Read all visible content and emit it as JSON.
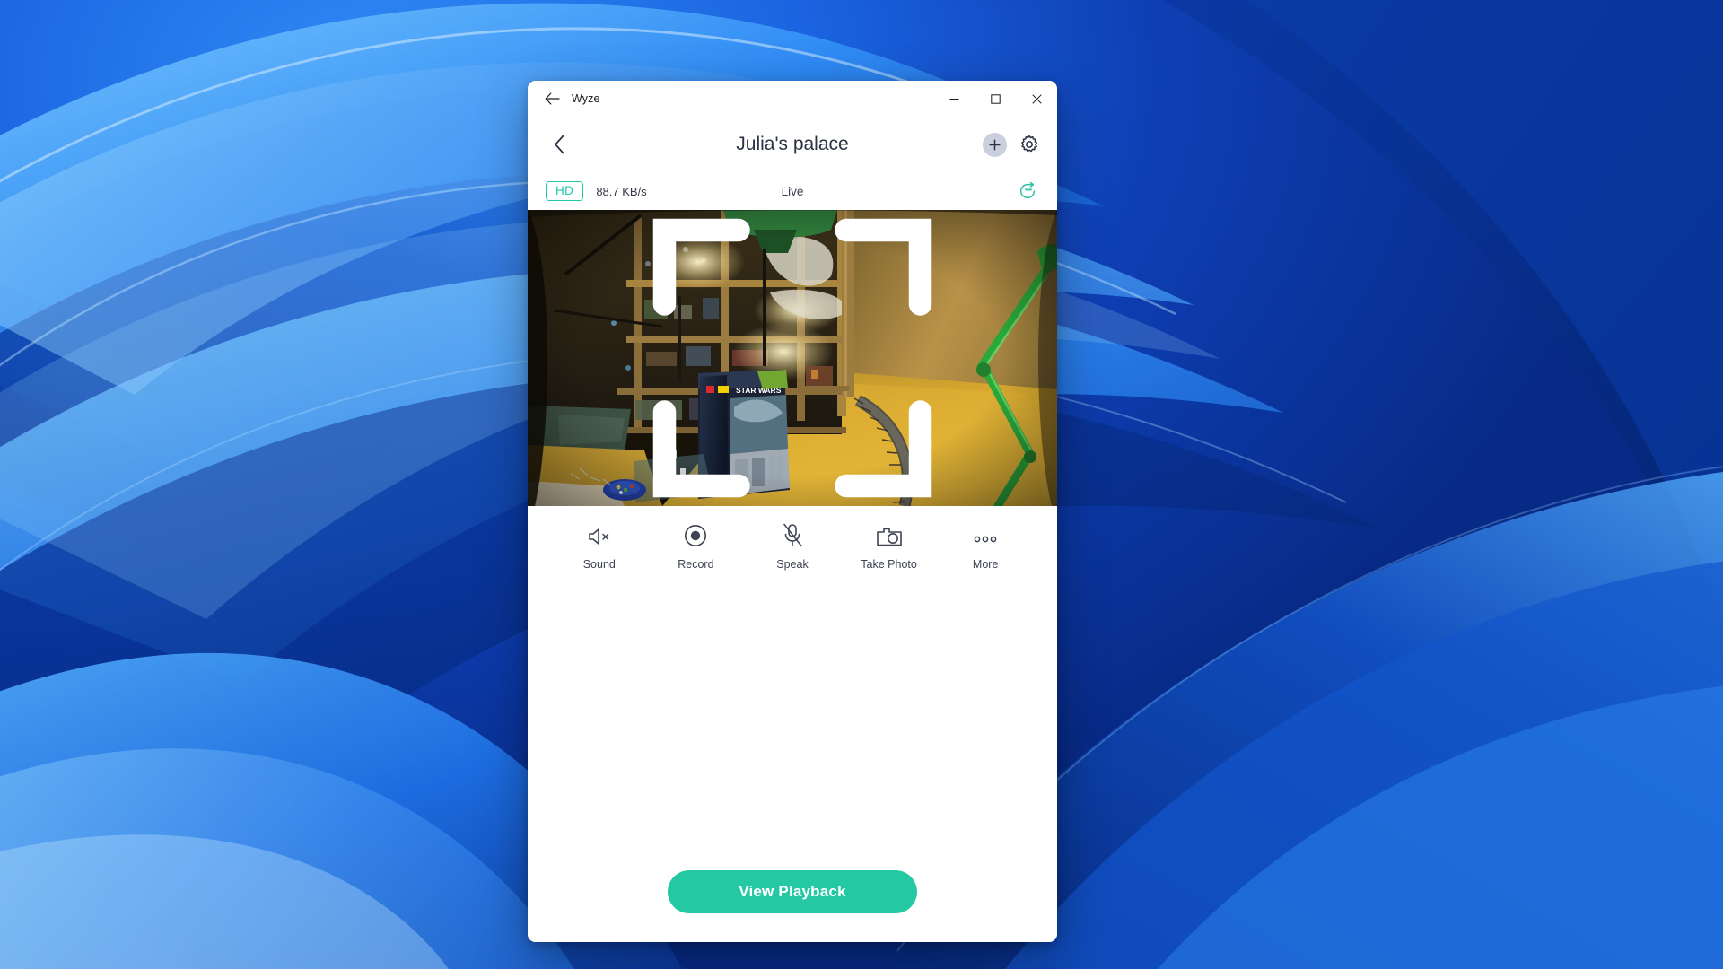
{
  "desktop": {
    "wallpaper_name": "windows-11-bloom-blue"
  },
  "window": {
    "titlebar": {
      "back_icon": "arrow-left-icon",
      "app_title": "Wyze",
      "minimize_label": "–",
      "maximize_label": "□",
      "close_label": "✕"
    },
    "header": {
      "back_icon": "chevron-left-icon",
      "title": "Julia's palace",
      "add_icon": "plus-circle-icon",
      "settings_icon": "gear-icon"
    },
    "status": {
      "quality_badge": "HD",
      "bitrate": "88.7 KB/s",
      "live_label": "Live",
      "flip_icon": "rotate-flip-icon",
      "badge_color": "#1fc9a8"
    },
    "video": {
      "fullscreen_icon": "fullscreen-expand-icon",
      "scene_description": "Indoor LEGO workshop room with wooden shelving, Star Wars LEGO box, train track on wooden floor and a green desk lamp"
    },
    "controls": [
      {
        "label": "Sound",
        "icon": "speaker-muted-icon"
      },
      {
        "label": "Record",
        "icon": "record-circle-icon"
      },
      {
        "label": "Speak",
        "icon": "microphone-muted-icon"
      },
      {
        "label": "Take Photo",
        "icon": "camera-icon"
      },
      {
        "label": "More",
        "icon": "ellipsis-icon"
      }
    ],
    "footer": {
      "playback_label": "View Playback",
      "playback_color": "#24c9a4"
    }
  }
}
